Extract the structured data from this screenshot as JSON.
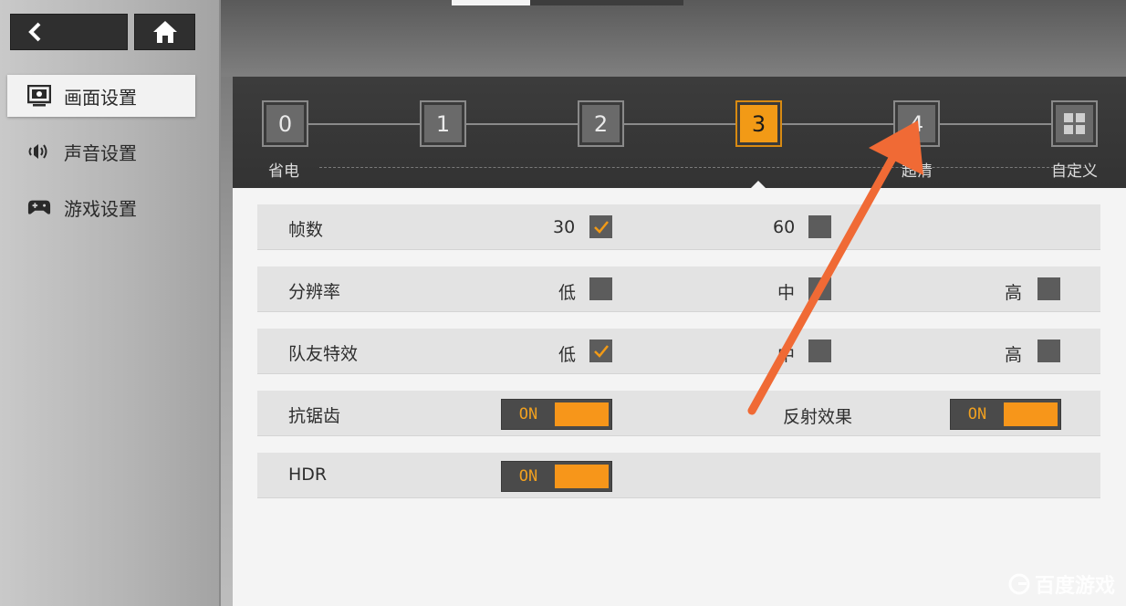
{
  "top_tabs": [
    "",
    ""
  ],
  "nav": {
    "back_icon": "back-arrow-icon",
    "home_icon": "home-icon"
  },
  "sidebar": {
    "items": [
      {
        "label": "画面设置",
        "icon": "display-settings-icon",
        "active": true
      },
      {
        "label": "声音设置",
        "icon": "speaker-icon",
        "active": false
      },
      {
        "label": "游戏设置",
        "icon": "gamepad-icon",
        "active": false
      }
    ]
  },
  "presets": {
    "levels": [
      "0",
      "1",
      "2",
      "3",
      "4"
    ],
    "selected": "3",
    "custom_icon": "grid-icon",
    "label_low": "省电",
    "label_high": "超清",
    "label_custom": "自定义"
  },
  "settings": {
    "fps": {
      "label": "帧数",
      "options": [
        {
          "label": "30",
          "checked": true
        },
        {
          "label": "60",
          "checked": false
        }
      ]
    },
    "resolution": {
      "label": "分辨率",
      "options": [
        {
          "label": "低",
          "checked": false
        },
        {
          "label": "中",
          "checked": false
        },
        {
          "label": "高",
          "checked": false
        }
      ]
    },
    "team_effects": {
      "label": "队友特效",
      "options": [
        {
          "label": "低",
          "checked": true
        },
        {
          "label": "中",
          "checked": false
        },
        {
          "label": "高",
          "checked": false
        }
      ]
    },
    "anti_aliasing": {
      "label": "抗锯齿",
      "state": "ON"
    },
    "reflection": {
      "label": "反射效果",
      "state": "ON"
    },
    "hdr": {
      "label": "HDR",
      "state": "ON"
    }
  },
  "colors": {
    "accent": "#f7961a",
    "annotation_arrow": "#f06a35"
  },
  "watermark": {
    "text": "百度游戏",
    "icon": "watermark-logo-icon"
  }
}
